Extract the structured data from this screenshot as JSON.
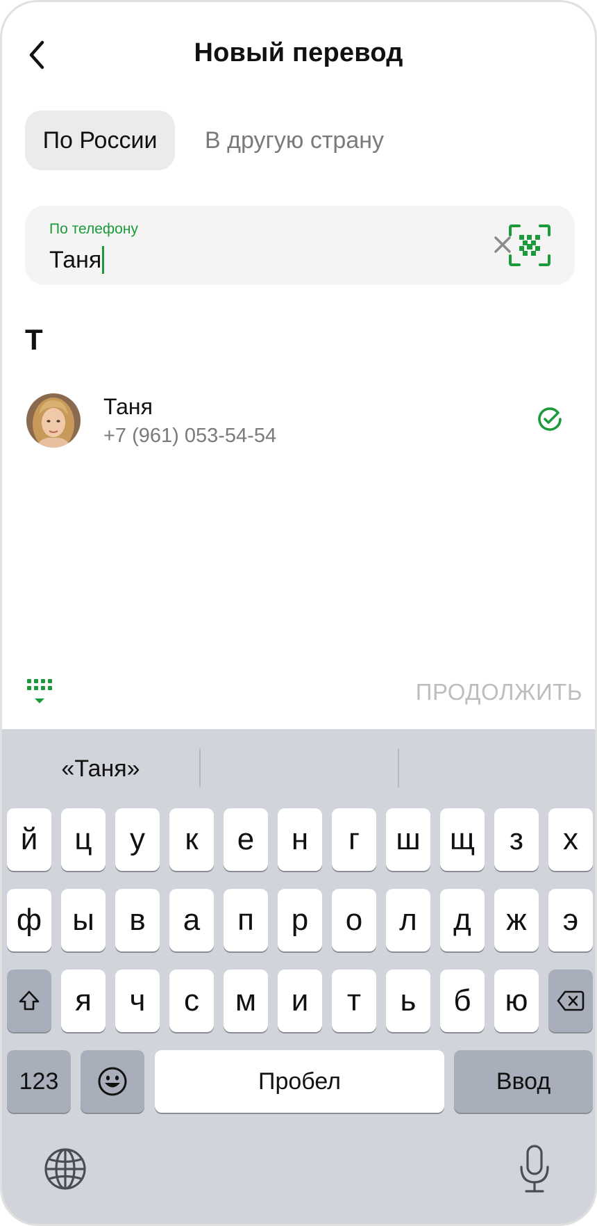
{
  "header": {
    "title": "Новый перевод"
  },
  "tabs": [
    {
      "label": "По России",
      "active": true
    },
    {
      "label": "В другую страну",
      "active": false
    }
  ],
  "search": {
    "label": "По телефону",
    "value": "Таня"
  },
  "section": {
    "letter": "Т"
  },
  "contact": {
    "name": "Таня",
    "phone": "+7 (961) 053-54-54"
  },
  "actions": {
    "continue": "ПРОДОЛЖИТЬ"
  },
  "keyboard": {
    "suggestions": [
      "«Таня»",
      "",
      ""
    ],
    "row1": [
      "й",
      "ц",
      "у",
      "к",
      "е",
      "н",
      "г",
      "ш",
      "щ",
      "з",
      "х"
    ],
    "row2": [
      "ф",
      "ы",
      "в",
      "а",
      "п",
      "р",
      "о",
      "л",
      "д",
      "ж",
      "э"
    ],
    "row3": [
      "я",
      "ч",
      "с",
      "м",
      "и",
      "т",
      "ь",
      "б",
      "ю"
    ],
    "numbers_label": "123",
    "space_label": "Пробел",
    "enter_label": "Ввод"
  },
  "colors": {
    "accent": "#1b9a39",
    "keyboard_bg": "#d1d4db",
    "muted": "#7a7a7a"
  },
  "icons": [
    "back-arrow-icon",
    "clear-icon",
    "qr-scan-icon",
    "check-circle-icon",
    "keypad-icon",
    "shift-icon",
    "backspace-icon",
    "emoji-icon",
    "globe-icon",
    "microphone-icon"
  ]
}
